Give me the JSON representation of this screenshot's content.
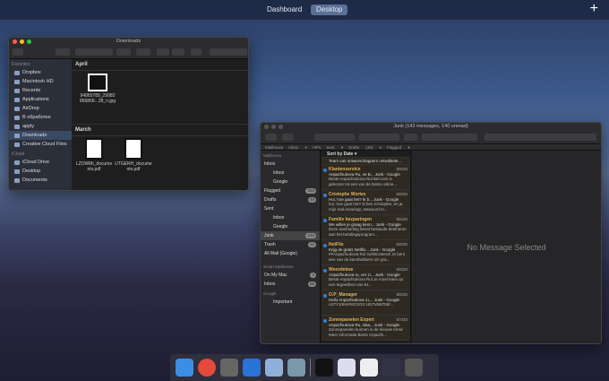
{
  "topbar": {
    "spaces": [
      "Dashboard",
      "Desktop"
    ],
    "add": "+"
  },
  "finder": {
    "title": "Downloads",
    "sidebar": {
      "favorites_header": "Favorites",
      "favorites": [
        "Dropbox",
        "Macintosh HD",
        "Recents",
        "Applications",
        "AirDrop",
        "В обработке",
        "apply",
        "Downloads",
        "Creative Cloud Files"
      ],
      "icloud_header": "iCloud",
      "icloud": [
        "iCloud Drive",
        "Desktop",
        "Documents"
      ]
    },
    "sections": [
      {
        "title": "April",
        "files": [
          "94865789_29983 866868...28_n.jpg"
        ]
      },
      {
        "title": "March",
        "files": [
          "LZOWMi_docume nts.pdf",
          "UTGENH_docume nts.pdf"
        ]
      }
    ]
  },
  "mail": {
    "title": "Junk (143 messages, 140 unread)",
    "favbar": [
      "Mailboxes",
      "Inbox ▾",
      "VIPs",
      "Sent ▾",
      "Drafts (40) ▾",
      "Flagged ▾"
    ],
    "sidebar": {
      "header": "Mailboxes",
      "items": [
        {
          "label": "Inbox",
          "sub": false
        },
        {
          "label": "Inbox",
          "sub": true
        },
        {
          "label": "Google",
          "sub": true
        },
        {
          "label": "Flagged",
          "sub": false,
          "badge": "253"
        },
        {
          "label": "Drafts",
          "sub": false,
          "badge": "40"
        },
        {
          "label": "Sent",
          "sub": false
        },
        {
          "label": "Inbox",
          "sub": true
        },
        {
          "label": "Google",
          "sub": true
        },
        {
          "label": "Junk",
          "sub": false,
          "badge": "143",
          "selected": true
        },
        {
          "label": "Trash",
          "sub": false,
          "badge": "12"
        },
        {
          "label": "All Mail (Google)",
          "sub": false
        }
      ],
      "smart_header": "Smart Mailboxes",
      "onmymac": "On My Mac",
      "onmymac_badge": "3",
      "inbox2": "Inbox",
      "inbox2_badge": "59",
      "google_header": "Google",
      "important": "Important"
    },
    "sort": "Sort by Date ▾",
    "first_preview": "Team van ontwerschappers ontwikkele...",
    "messages": [
      {
        "from": "Klantenservice",
        "date": "5/6/20",
        "sub": "Anpazfsukova Ru, ve B... Junk - Google",
        "prev": "Beste Anpazfsukova Rul Bel.com is gekozen tot een van de beste online..."
      },
      {
        "from": "Cristophe Wortex",
        "date": "5/6/20",
        "sub": "Hoi, hoe gaat het? Ik b... Junk - Google",
        "prev": "hoi, hoe gaat het? Ik ben Cristophe, en ja mijn real ervaringt, antwoord m..."
      },
      {
        "from": "Familie bezparingen",
        "date": "5/6/20",
        "sub": "We willen je graag kenn... Junk - Google",
        "prev": "Deze aanbieding bevat beslaude deelname aan het betalingsprogram..."
      },
      {
        "from": "NetFlix",
        "date": "5/6/20",
        "sub": "Krijg de gratis Netflix... Junk - Google",
        "prev": "##Anpazfsukova Rul Gefeliciteerd! Je bent een van de kanshebbers om gra..."
      },
      {
        "from": "Woordeboe",
        "date": "5/6/20",
        "sub": "Anpazfsukova ru, ver zi... Junk - Google",
        "prev": "Beste Anpazfsukova Rul Je moet kans op een tegoedbon van €1..."
      },
      {
        "from": "O.P_Manager",
        "date": "5/6/20",
        "sub": "Hello Anpazfsukova ru,... Junk - Google",
        "prev": "A37Y10KKR6CSO3 1627vh8t759f..."
      },
      {
        "from": "Zonnepanelen Expert",
        "date": "5/7/20",
        "sub": "Anpazfsukova Ru, slaa... Junk - Google",
        "prev": "Zonnepanelen kunnen is de nieuwe trend Meer informatie Beste Anpazfs..."
      }
    ],
    "empty": "No Message Selected"
  },
  "dock": {
    "apps": [
      "Finder",
      "Chrome",
      "System Preferences",
      "Word",
      "Preview",
      "Photos",
      "Document",
      "Screenshot",
      "Screenshot",
      "Downloads",
      "Trash"
    ],
    "colors": [
      "#3a8ee6",
      "#e4493c",
      "#666",
      "#2b72d6",
      "#8fb0d8",
      "#7799aa",
      "#111",
      "#dde",
      "#eee",
      "#334",
      "#555"
    ]
  }
}
